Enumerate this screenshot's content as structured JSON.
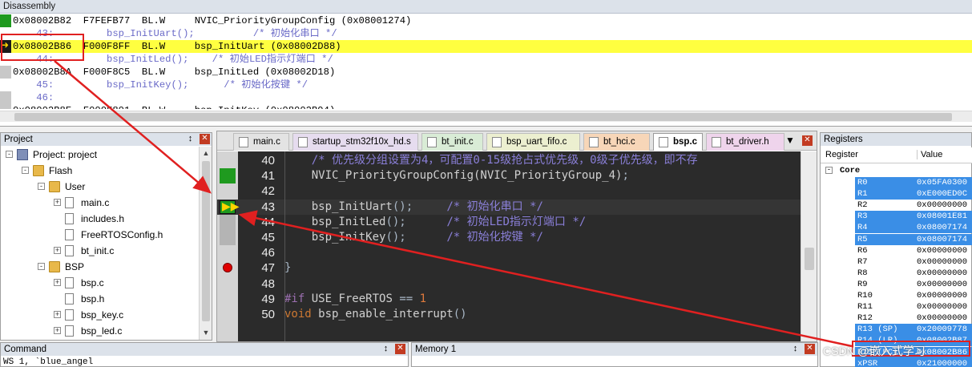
{
  "disassembly": {
    "title": "Disassembly",
    "lines": [
      {
        "text": "0x08002B82  F7FEFB77  BL.W     NVIC_PriorityGroupConfig (0x08001274)",
        "kind": "asm",
        "marker": "green"
      },
      {
        "text": "    43:         bsp_InitUart();          /* 初始化串口 */",
        "kind": "src",
        "marker": ""
      },
      {
        "text": "0x08002B86  F000F8FF  BL.W     bsp_InitUart (0x08002D88)",
        "kind": "asm",
        "marker": "arrow",
        "highlight": true
      },
      {
        "text": "    44:         bsp_InitLed();    /* 初始LED指示灯端口 */",
        "kind": "src",
        "marker": ""
      },
      {
        "text": "0x08002B8A  F000F8C5  BL.W     bsp_InitLed (0x08002D18)",
        "kind": "asm",
        "marker": "gray"
      },
      {
        "text": "    45:         bsp_InitKey();      /* 初始化按键 */",
        "kind": "src",
        "marker": ""
      },
      {
        "text": "    46:",
        "kind": "src",
        "marker": "gray"
      },
      {
        "text": "0x08002B8E  F000F801  BL.W     bsp_InitKey (0x08002B94)",
        "kind": "asm",
        "marker": "gray"
      }
    ]
  },
  "project": {
    "title": "Project",
    "tree": [
      {
        "label": "Project: project",
        "level": 0,
        "icon": "project-icon",
        "expander": "-"
      },
      {
        "label": "Flash",
        "level": 1,
        "icon": "folder-icon",
        "expander": "-"
      },
      {
        "label": "User",
        "level": 2,
        "icon": "folder-icon",
        "expander": "-"
      },
      {
        "label": "main.c",
        "level": 3,
        "icon": "file-icon",
        "expander": "+"
      },
      {
        "label": "includes.h",
        "level": 3,
        "icon": "file-icon",
        "expander": ""
      },
      {
        "label": "FreeRTOSConfig.h",
        "level": 3,
        "icon": "file-icon",
        "expander": ""
      },
      {
        "label": "bt_init.c",
        "level": 3,
        "icon": "file-icon",
        "expander": "+"
      },
      {
        "label": "BSP",
        "level": 2,
        "icon": "folder-icon",
        "expander": "-"
      },
      {
        "label": "bsp.c",
        "level": 3,
        "icon": "file-icon",
        "expander": "+"
      },
      {
        "label": "bsp.h",
        "level": 3,
        "icon": "file-icon",
        "expander": ""
      },
      {
        "label": "bsp_key.c",
        "level": 3,
        "icon": "file-icon",
        "expander": "+"
      },
      {
        "label": "bsp_led.c",
        "level": 3,
        "icon": "file-icon",
        "expander": "+"
      }
    ]
  },
  "editor": {
    "tabs": [
      {
        "label": "main.c",
        "color": "#e3e3e3",
        "active": false
      },
      {
        "label": "startup_stm32f10x_hd.s",
        "color": "#e6dcef",
        "active": false
      },
      {
        "label": "bt_init.c",
        "color": "#d9ecd6",
        "active": false
      },
      {
        "label": "bsp_uart_fifo.c",
        "color": "#ecefd0",
        "active": false
      },
      {
        "label": "bt_hci.c",
        "color": "#f7d6b8",
        "active": false
      },
      {
        "label": "bsp.c",
        "color": "#ffffff",
        "active": true
      },
      {
        "label": "bt_driver.h",
        "color": "#efd4ec",
        "active": false
      }
    ],
    "lines": [
      {
        "num": "40",
        "marker": "",
        "html": "    <span class='c'>/* 优先级分组设置为4，可配置0-15级抢占式优先级，0级子优先级，即不存</span>"
      },
      {
        "num": "41",
        "marker": "green",
        "html": "    NVIC_PriorityGroupConfig(NVIC_PriorityGroup_4)<span class='p'>;</span>"
      },
      {
        "num": "42",
        "marker": "",
        "html": ""
      },
      {
        "num": "43",
        "marker": "arrow",
        "html": "    bsp_InitUart<span class='p'>();</span>     <span class='c'>/* 初始化串口 */</span>",
        "current": true
      },
      {
        "num": "44",
        "marker": "gray",
        "html": "    bsp_InitLed<span class='p'>();</span>      <span class='c'>/* 初始LED指示灯端口 */</span>"
      },
      {
        "num": "45",
        "marker": "gray",
        "html": "    bsp_InitKey<span class='p'>();</span>      <span class='c'>/* 初始化按键 */</span>"
      },
      {
        "num": "46",
        "marker": "",
        "html": ""
      },
      {
        "num": "47",
        "marker": "breakpoint",
        "html": "<span class='p'>}</span>"
      },
      {
        "num": "48",
        "marker": "",
        "html": ""
      },
      {
        "num": "49",
        "marker": "",
        "html": "<span class='m'>#if</span> USE_FreeRTOS <span class='p'>==</span> <span class='n'>1</span>"
      },
      {
        "num": "50",
        "marker": "",
        "html": "<span class='k'>void</span> bsp_enable_interrupt<span class='p'>()</span>"
      }
    ]
  },
  "registers": {
    "title": "Registers",
    "col_register": "Register",
    "col_value": "Value",
    "group": "Core",
    "rows": [
      {
        "name": "R0",
        "value": "0x05FA0300",
        "sel": true
      },
      {
        "name": "R1",
        "value": "0xE000ED0C",
        "sel": true
      },
      {
        "name": "R2",
        "value": "0x00000000",
        "sel": false
      },
      {
        "name": "R3",
        "value": "0x08001E81",
        "sel": true
      },
      {
        "name": "R4",
        "value": "0x08007174",
        "sel": true
      },
      {
        "name": "R5",
        "value": "0x08007174",
        "sel": true
      },
      {
        "name": "R6",
        "value": "0x00000000",
        "sel": false
      },
      {
        "name": "R7",
        "value": "0x00000000",
        "sel": false
      },
      {
        "name": "R8",
        "value": "0x00000000",
        "sel": false
      },
      {
        "name": "R9",
        "value": "0x00000000",
        "sel": false
      },
      {
        "name": "R10",
        "value": "0x00000000",
        "sel": false
      },
      {
        "name": "R11",
        "value": "0x00000000",
        "sel": false
      },
      {
        "name": "R12",
        "value": "0x00000000",
        "sel": false
      },
      {
        "name": "R13 (SP)",
        "value": "0x20009778",
        "sel": true
      },
      {
        "name": "R14 (LR)",
        "value": "0x08002B87",
        "sel": true
      },
      {
        "name": "R15 (PC)",
        "value": "0x08002B86",
        "sel": true
      },
      {
        "name": "xPSR",
        "value": "0x21000000",
        "sel": true
      }
    ]
  },
  "command": {
    "title": "Command",
    "text": "WS 1, `blue_angel"
  },
  "memory": {
    "title": "Memory 1"
  },
  "watermark": "CSDN @嵌入式学习"
}
